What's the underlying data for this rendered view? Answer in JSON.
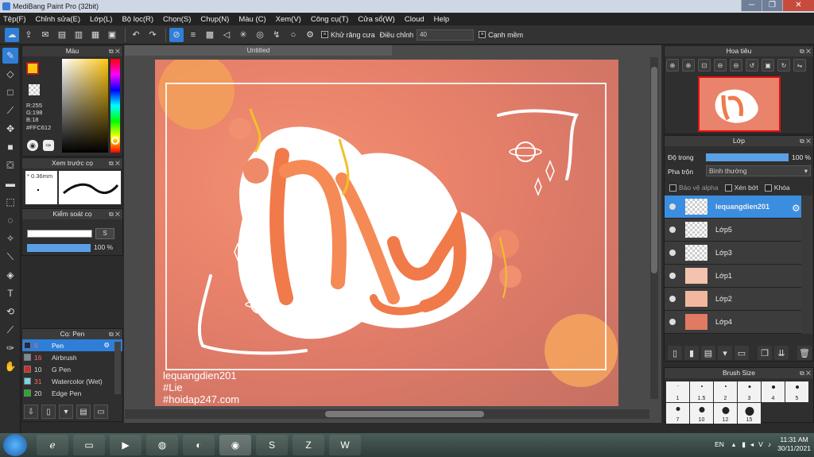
{
  "window": {
    "title": "MediBang Paint Pro (32bit)",
    "minimize": "─",
    "restore": "❐",
    "close": "✕"
  },
  "menu": [
    "Tệp(F)",
    "Chỉnh sửa(E)",
    "Lớp(L)",
    "Bộ lọc(R)",
    "Chọn(S)",
    "Chụp(N)",
    "Màu (C)",
    "Xem(V)",
    "Công cụ(T)",
    "Cửa sổ(W)",
    "Cloud",
    "Help"
  ],
  "toolbar": {
    "antialias_label": "Khử răng cưa",
    "adjust_label": "Điều chỉnh",
    "adjust_value": "40",
    "smooth_edges_label": "Cạnh mềm",
    "check": "×",
    "x": "×"
  },
  "color_panel": {
    "title": "Màu",
    "r": "R:255",
    "g": "G:198",
    "b": "B:18",
    "hex": "#FFC612"
  },
  "preview_panel": {
    "title": "Xem trước cọ",
    "size": "* 0.36mm"
  },
  "control_panel": {
    "title": "Kiểm soát cọ",
    "size_btn": "S",
    "opacity": "100 %"
  },
  "brush_panel": {
    "title": "Cọ: Pen",
    "items": [
      {
        "num": "5",
        "name": "Pen",
        "color": "#1b2a5c"
      },
      {
        "num": "16",
        "name": "Airbrush",
        "color": "#7a8a9a"
      },
      {
        "num": "10",
        "name": "G Pen",
        "color": "#d42a2a"
      },
      {
        "num": "31",
        "name": "Watercolor (Wet)",
        "color": "#7ad4e6"
      },
      {
        "num": "20",
        "name": "Edge Pen",
        "color": "#2aa82a"
      }
    ]
  },
  "document": {
    "tab": "Untitled"
  },
  "canvas_text": {
    "signature_line1": "lequangdien201",
    "signature_line2": "#Lie",
    "signature_line3": "#hoidap247.com"
  },
  "navigator": {
    "title": "Hoa tiêu"
  },
  "layer_panel": {
    "title": "Lớp",
    "opacity_label": "Độ trong",
    "opacity_value": "100 %",
    "blend_label": "Pha trộn",
    "blend_value": "Bình thường",
    "protect_alpha": "Bảo vệ alpha",
    "clipping": "Xén bớt",
    "lock": "Khóa",
    "layers": [
      "lequangdien201",
      "Lớp5",
      "Lớp3",
      "Lớp1",
      "Lớp2",
      "Lớp4"
    ]
  },
  "brushsize_panel": {
    "title": "Brush Size",
    "sizes": [
      "1",
      "1.5",
      "2",
      "3",
      "4",
      "5",
      "7",
      "10",
      "12",
      "15"
    ]
  },
  "taskbar": {
    "lang": "EN",
    "time": "11:31 AM",
    "date": "30/11/2021"
  }
}
